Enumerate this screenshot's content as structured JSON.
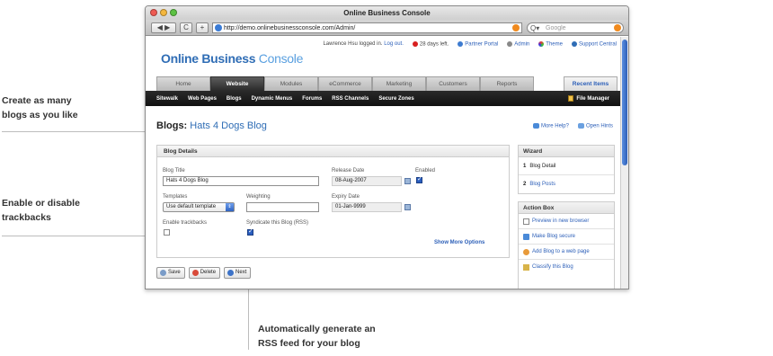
{
  "annotations": {
    "blogs_line1": "Create as many",
    "blogs_line2": "blogs as you like",
    "trackback_line1": "Enable or disable",
    "trackback_line2": "trackbacks",
    "rss_line1": "Automatically generate an",
    "rss_line2": "RSS feed for your blog"
  },
  "window": {
    "title": "Online Business Console",
    "url": "http://demo.onlinebusinessconsole.com/Admin/",
    "search_placeholder": "Google",
    "back_label": "◀ ▶",
    "reload_label": "C",
    "add_label": "+"
  },
  "topbar": {
    "user_text": "Lawrence Hsu logged in.",
    "logout": "Log out.",
    "days_left": "28 days left.",
    "partner_portal": "Partner Portal",
    "admin": "Admin",
    "theme": "Theme",
    "support": "Support Central"
  },
  "logo": {
    "bold": "Online Business",
    "thin": "Console"
  },
  "tabs": [
    "Home",
    "Website",
    "Modules",
    "eCommerce",
    "Marketing",
    "Customers",
    "Reports"
  ],
  "active_tab": "Website",
  "recent_items": "Recent Items",
  "subnav": [
    "Sitewalk",
    "Web Pages",
    "Blogs",
    "Dynamic Menus",
    "Forums",
    "RSS Channels",
    "Secure Zones"
  ],
  "file_manager": "File Manager",
  "page": {
    "title_prefix": "Blogs:",
    "title_name": "Hats 4 Dogs Blog",
    "more_help": "More Help?",
    "open_hints": "Open Hints"
  },
  "blog_details": {
    "heading": "Blog Details",
    "blog_title_label": "Blog Title",
    "blog_title_value": "Hats 4 Dogs Blog",
    "release_date_label": "Release Date",
    "release_date_value": "08-Aug-2007",
    "enabled_label": "Enabled",
    "enabled": true,
    "templates_label": "Templates",
    "templates_value": "Use default template",
    "weighting_label": "Weighting",
    "weighting_value": "",
    "expiry_date_label": "Expiry Date",
    "expiry_date_value": "01-Jan-9999",
    "trackbacks_label": "Enable trackbacks",
    "trackbacks": false,
    "syndicate_label": "Syndicate this Blog (RSS)",
    "syndicate": true,
    "show_more": "Show More Options"
  },
  "buttons": {
    "save": "Save",
    "delete": "Delete",
    "next": "Next"
  },
  "wizard": {
    "heading": "Wizard",
    "items": [
      {
        "num": "1",
        "label": "Blog Detail"
      },
      {
        "num": "2",
        "label": "Blog Posts"
      }
    ]
  },
  "action_box": {
    "heading": "Action Box",
    "items": [
      "Preview in new browser",
      "Make Blog secure",
      "Add Blog to a web page",
      "Classify this Blog"
    ]
  },
  "colors": {
    "brand_blue": "#2f6db5",
    "link_blue": "#2c5fb8",
    "nav_dark": "#1a1a1a"
  }
}
